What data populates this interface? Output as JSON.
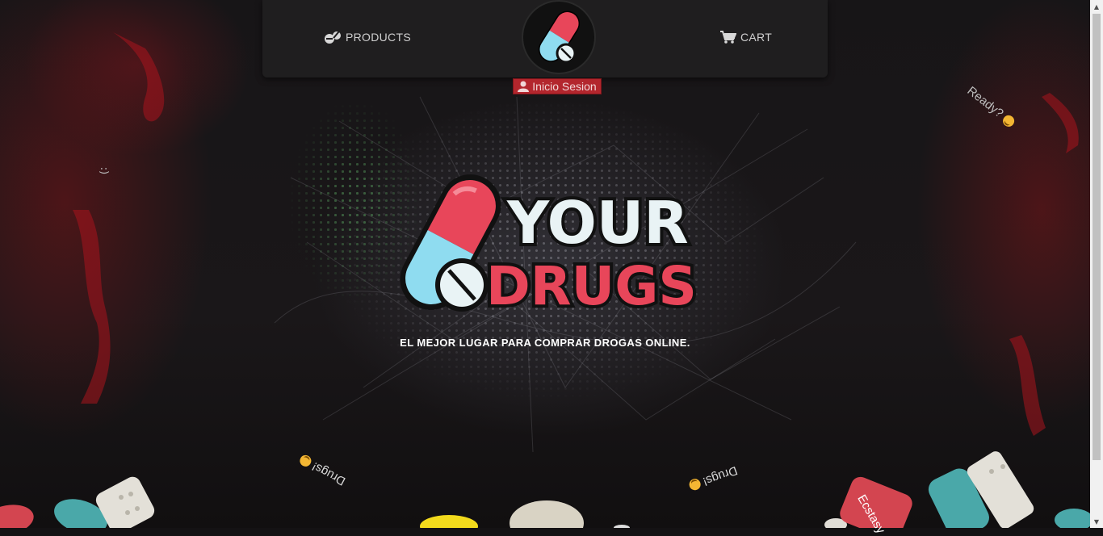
{
  "nav": {
    "products_label": "PRODUCTS",
    "cart_label": "CART",
    "login_label": "Inicio Sesion"
  },
  "brand": {
    "logo_line1": "YOUR",
    "logo_line2": "DRUGS",
    "tagline": "EL MEJOR LUGAR PARA COMPRAR DROGAS ONLINE."
  },
  "floating_text": {
    "ready": "Ready?",
    "drugs_left": "Drugs!",
    "drugs_right": "Drugs!",
    "ecstasy": "Ecstasy",
    "smiley": ":)"
  },
  "colors": {
    "accent_red": "#e8465a",
    "accent_blue": "#8fdcf0",
    "login_bg": "#b3262d",
    "navbar_bg": "#1f1e1f"
  },
  "icons": [
    "pills-icon",
    "cart-icon",
    "user-icon",
    "logo-pill-icon",
    "smile-emoji-icon"
  ]
}
